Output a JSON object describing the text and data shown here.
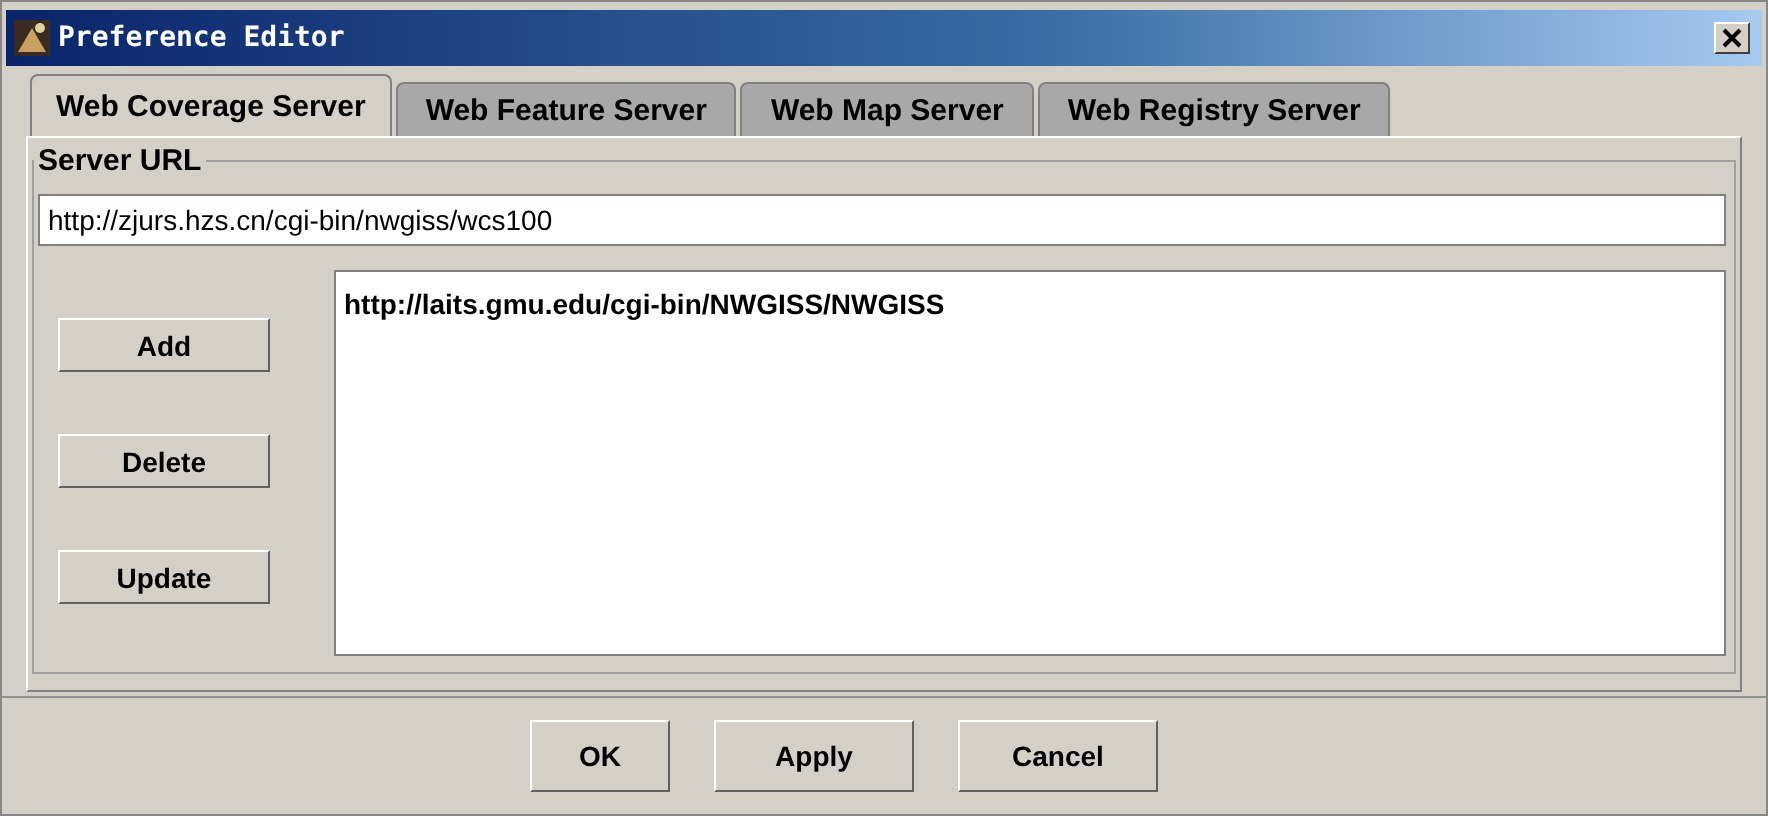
{
  "window": {
    "title": "Preference Editor"
  },
  "tabs": [
    {
      "label": "Web Coverage Server",
      "selected": true
    },
    {
      "label": "Web Feature Server",
      "selected": false
    },
    {
      "label": "Web Map Server",
      "selected": false
    },
    {
      "label": "Web Registry Server",
      "selected": false
    }
  ],
  "server_url": {
    "label": "Server URL",
    "value": "http://zjurs.hzs.cn/cgi-bin/nwgiss/wcs100"
  },
  "side_buttons": [
    "Add",
    "Delete",
    "Update"
  ],
  "server_list": [
    "http://laits.gmu.edu/cgi-bin/NWGISS/NWGISS"
  ],
  "buttons": [
    "OK",
    "Apply",
    "Cancel"
  ]
}
